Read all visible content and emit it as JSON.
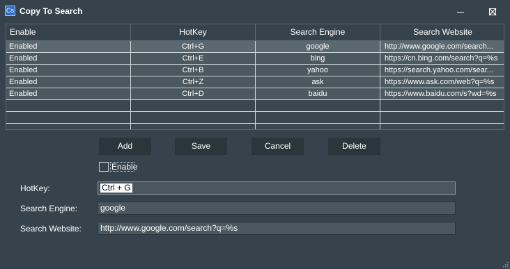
{
  "window": {
    "title": "Copy To Search",
    "icon_text": "Cs",
    "icon": "app-icon",
    "controls": [
      "minimize-icon",
      "maximize-icon",
      "close-icon"
    ]
  },
  "table": {
    "columns": [
      "Enable",
      "HotKey",
      "Search Engine",
      "Search Website"
    ],
    "rows": [
      {
        "enable": "Enabled",
        "hotkey": "Ctrl+G",
        "engine": "google",
        "website": "http://www.google.com/search..."
      },
      {
        "enable": "Enabled",
        "hotkey": "Ctrl+E",
        "engine": "bing",
        "website": "https://cn.bing.com/search?q=%s"
      },
      {
        "enable": "Enabled",
        "hotkey": "Ctrl+B",
        "engine": "yahoo",
        "website": "https://search.yahoo.com/sear..."
      },
      {
        "enable": "Enabled",
        "hotkey": "Ctrl+Z",
        "engine": "ask",
        "website": "https://www.ask.com/web?q=%s"
      },
      {
        "enable": "Enabled",
        "hotkey": "Ctrl+D",
        "engine": "baidu",
        "website": "https://www.baidu.com/s?wd=%s"
      }
    ]
  },
  "buttons": {
    "add": "Add",
    "save": "Save",
    "cancel": "Cancel",
    "delete": "Delete"
  },
  "form": {
    "enable_label": "Enable",
    "enable_checked": false,
    "hotkey_label": "HotKey:",
    "hotkey_value": "Ctrl + G",
    "engine_label": "Search Engine:",
    "engine_value": "google",
    "website_label": "Search Website:",
    "website_value": "http://www.google.com/search?q=%s"
  },
  "colors": {
    "background": "#37434c",
    "row_fill": "#4b585f",
    "button_bg": "#2a353c",
    "field_bg": "#4a575e"
  }
}
